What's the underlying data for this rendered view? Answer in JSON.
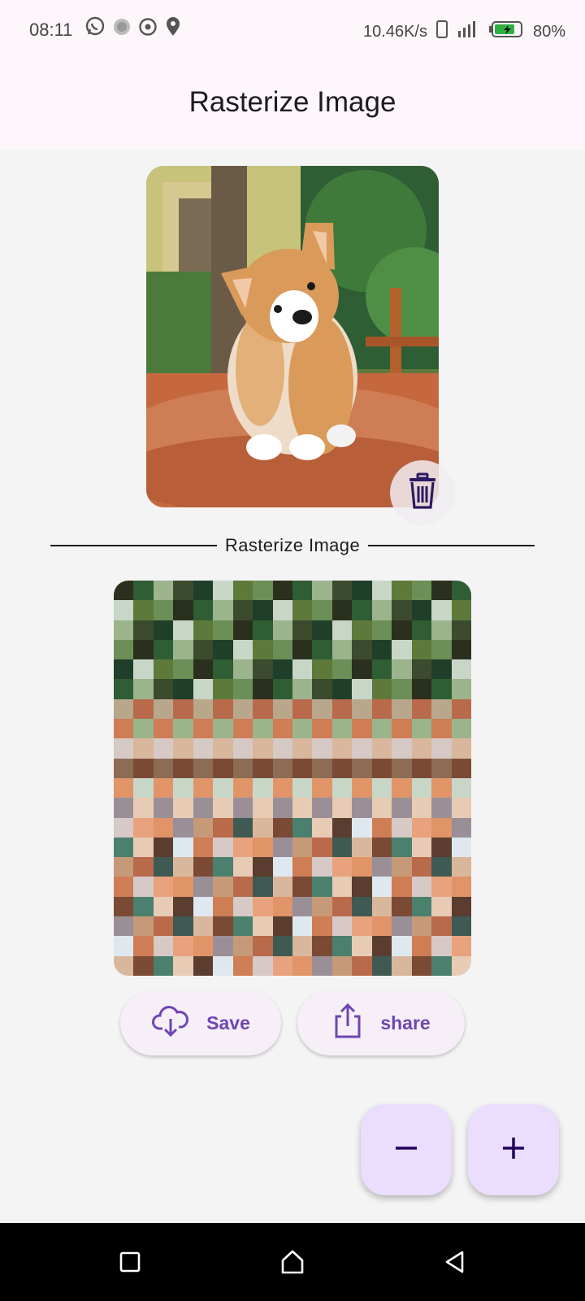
{
  "status_bar": {
    "time": "08:11",
    "left_icons": [
      "whatsapp-icon",
      "app-icon",
      "settings-circle-icon",
      "location-icon"
    ],
    "network_speed": "10.46K/s",
    "battery_percent": "80%",
    "battery_level": 0.8,
    "battery_charging": true
  },
  "app_bar": {
    "title": "Rasterize Image"
  },
  "original": {
    "delete_icon": "trash-icon"
  },
  "divider": {
    "label": "Rasterize Image"
  },
  "raster": {
    "cols": 18,
    "rows": 20,
    "palette": [
      "#2b2f1e",
      "#3c4a2e",
      "#5e7a3a",
      "#2f5d34",
      "#1f3f2a",
      "#6b8f57",
      "#9cb48c",
      "#c8d6c8",
      "#b8a78b",
      "#8c6c55",
      "#c69a78",
      "#d9b79c",
      "#e7cbb4",
      "#cf7d55",
      "#e09468",
      "#b86a4a",
      "#7b4a34",
      "#5a3d2e",
      "#d7c9c6",
      "#9a8f97",
      "#3e5a52",
      "#4b7f6e",
      "#dfe8ef",
      "#e8a27e"
    ]
  },
  "actions": {
    "save_label": "Save",
    "share_label": "share",
    "save_icon": "cloud-download-icon",
    "share_icon": "share-icon"
  },
  "fabs": {
    "minus_icon": "minus-icon",
    "plus_icon": "plus-icon"
  },
  "nav": {
    "recents": "square-icon",
    "home": "home-icon",
    "back": "back-triangle-icon"
  }
}
